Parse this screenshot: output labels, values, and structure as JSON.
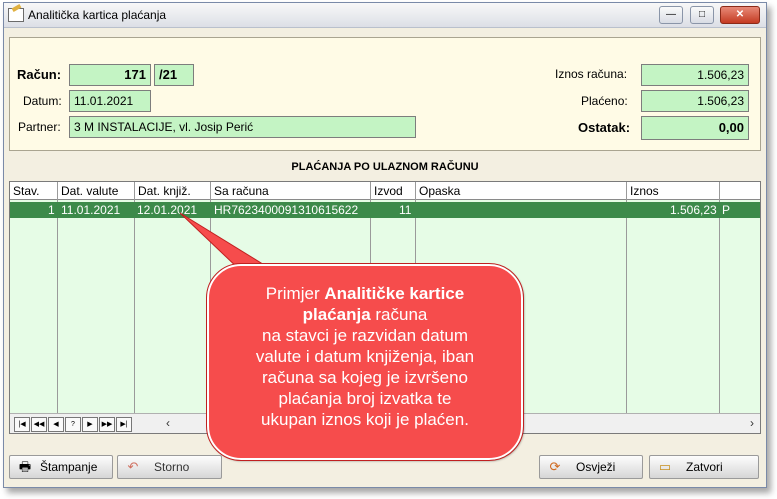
{
  "window": {
    "title": "Analitička kartica plaćanja",
    "buttons": {
      "minimize": "—",
      "maximize": "□",
      "close": "✕"
    }
  },
  "header": {
    "racun_label": "Račun:",
    "racun_broj": "171",
    "racun_godina": "/21",
    "datum_label": "Datum:",
    "datum_value": "11.01.2021",
    "partner_label": "Partner:",
    "partner_value": "3 M INSTALACIJE, vl. Josip Perić",
    "iznos_label": "Iznos računa:",
    "iznos_value": "1.506,23",
    "placeno_label": "Plaćeno:",
    "placeno_value": "1.506,23",
    "ostatak_label": "Ostatak:",
    "ostatak_value": "0,00"
  },
  "section_title": "PLAĆANJA PO ULAZNOM RAČUNU",
  "table": {
    "columns": [
      "Stav.",
      "Dat. valute",
      "Dat. knjiž.",
      "Sa računa",
      "Izvod",
      "Opaska",
      "Iznos"
    ],
    "rows": [
      {
        "stav": "1",
        "dat_valute": "11.01.2021",
        "dat_knjiz": "12.01.2021",
        "sa_racuna": "HR7623400091310615622",
        "izvod": "11",
        "opaska": "",
        "iznos": "1.506,23",
        "flag": "P"
      }
    ]
  },
  "navigator": [
    "|◀",
    "◀◀",
    "◀",
    "?",
    "▶",
    "▶▶",
    "▶|"
  ],
  "scroll": {
    "left": "‹",
    "right": "›"
  },
  "buttons": {
    "print": "Štampanje",
    "storno": "Storno",
    "refresh": "Osvježi",
    "close": "Zatvori"
  },
  "callout": {
    "line1_pre": "Primjer ",
    "line1_bold": "Analitičke kartice",
    "line2_bold": "plaćanja",
    "line2_rest": " računa",
    "line3": "na stavci je razvidan datum",
    "line4": "valute i datum knjiženja, iban",
    "line5": "računa sa kojeg je izvršeno",
    "line6": "plaćanja broj izvatka te",
    "line7": "ukupan iznos koji je plaćen."
  },
  "colors": {
    "field_green": "#c4f4c4",
    "grid_bg": "#e6fce6",
    "selected_row": "#3c8a4a",
    "callout_red": "#f64c4c"
  }
}
